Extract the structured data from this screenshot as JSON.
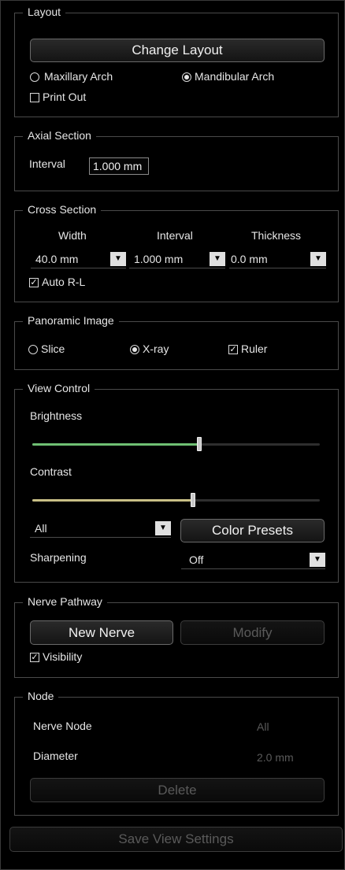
{
  "layout": {
    "title": "Layout",
    "change_layout": "Change Layout",
    "maxillary": "Maxillary Arch",
    "mandibular": "Mandibular Arch",
    "print_out": "Print Out",
    "selected_arch": "mandibular",
    "print_out_checked": false
  },
  "axial": {
    "title": "Axial Section",
    "interval_label": "Interval",
    "interval_value": "1.000 mm"
  },
  "cross": {
    "title": "Cross Section",
    "width_label": "Width",
    "interval_label": "Interval",
    "thickness_label": "Thickness",
    "width_value": "40.0 mm",
    "interval_value": "1.000 mm",
    "thickness_value": "0.0 mm",
    "auto_rl": "Auto R-L",
    "auto_rl_checked": true
  },
  "panoramic": {
    "title": "Panoramic Image",
    "slice": "Slice",
    "xray": "X-ray",
    "ruler": "Ruler",
    "selected": "xray",
    "ruler_checked": true
  },
  "view": {
    "title": "View Control",
    "brightness_label": "Brightness",
    "brightness_level": 0.58,
    "brightness_color": "#6fbf73",
    "contrast_label": "Contrast",
    "contrast_level": 0.56,
    "contrast_color": "#c8bf86",
    "preset_value": "All",
    "color_presets": "Color Presets",
    "sharpening_label": "Sharpening",
    "sharpening_value": "Off"
  },
  "nerve": {
    "title": "Nerve Pathway",
    "new_nerve": "New Nerve",
    "modify": "Modify",
    "visibility": "Visibility",
    "visibility_checked": true
  },
  "node": {
    "title": "Node",
    "nerve_node_label": "Nerve Node",
    "nerve_node_value": "All",
    "diameter_label": "Diameter",
    "diameter_value": "2.0 mm",
    "delete": "Delete"
  },
  "save_view_settings": "Save View Settings"
}
